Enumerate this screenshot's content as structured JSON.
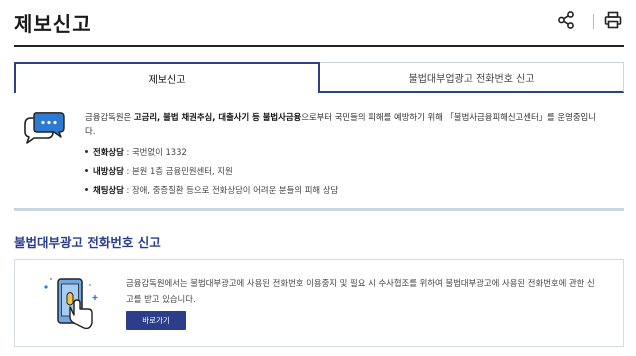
{
  "header": {
    "title": "제보신고",
    "share_icon": "share-icon",
    "print_icon": "printer-icon"
  },
  "tabs": [
    {
      "label": "제보신고",
      "active": true
    },
    {
      "label": "불법대부업광고 전화번호 신고",
      "active": false
    }
  ],
  "report": {
    "icon": "chat-bubbles-icon",
    "intro_prefix": "금융감독원은 ",
    "intro_bold": "고금리, 불법 채권추심, 대출사기 등 불법사금융",
    "intro_suffix": "으로부터 국민들의 피해를 예방하기 위해 「불법사금융피해신고센터」를 운영중입니다.",
    "items": [
      {
        "label": "전화상담",
        "value": " : 국번없이 1332"
      },
      {
        "label": "내방상담",
        "value": " : 본원 1층 금융민원센터, 지원"
      },
      {
        "label": "채팅상담",
        "value": " : 장애, 중증질환 등으로 전화상담이 어려운 분들의 피해 상담"
      }
    ]
  },
  "ad_report": {
    "section_title": "불법대부광고 전화번호 신고",
    "illustration": "phone-touch-icon",
    "description": "금융감독원에서는 불법대부광고에 사용된 전화번호 이용중지 및 필요 시 수사협조를 위하여 불법대부광고에 사용된 전화번호에 관한 신고를 받고 있습니다.",
    "button_label": "바로가기"
  },
  "colors": {
    "accent": "#2c3d8a",
    "divider": "#c9d6e3",
    "icon_blue": "#2e7ad1"
  }
}
